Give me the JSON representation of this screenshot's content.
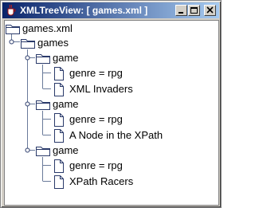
{
  "window": {
    "title": "XMLTreeView: [ games.xml ]",
    "icon": "java-cup-icon",
    "controls": [
      "minimize-icon",
      "maximize-icon",
      "close-icon"
    ]
  },
  "tree": {
    "root": "games.xml",
    "games": "games",
    "items": [
      {
        "node": "game",
        "attribute": "genre = rpg",
        "name": "XML Invaders"
      },
      {
        "node": "game",
        "attribute": "genre = rpg",
        "name": "A Node in the XPath"
      },
      {
        "node": "game",
        "attribute": "genre = rpg",
        "name": "XPath Racers"
      }
    ]
  },
  "colors": {
    "titlebar_start": "#0a246a",
    "titlebar_end": "#a6caf0",
    "tree_line": "#6a7a9a"
  }
}
